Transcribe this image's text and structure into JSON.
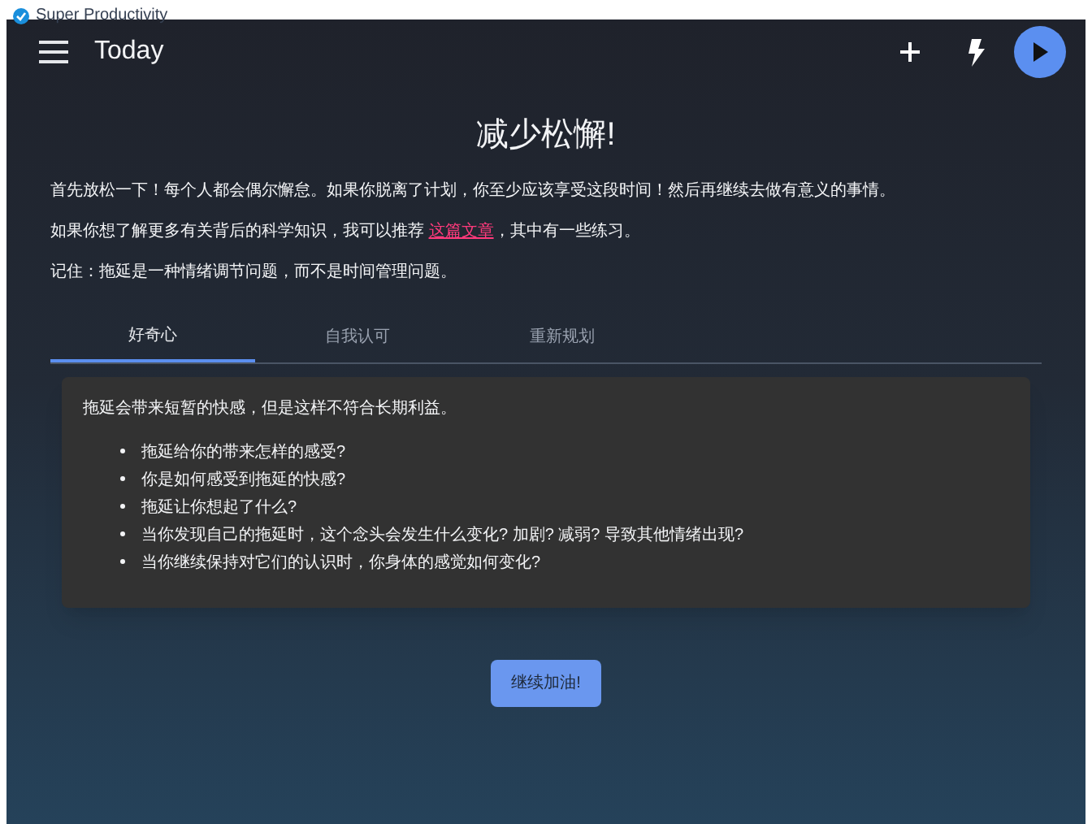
{
  "window": {
    "title": "Super Productivity"
  },
  "toolbar": {
    "title": "Today"
  },
  "heading": "减少松懈!",
  "paragraphs": [
    {
      "kind": "text",
      "text": "首先放松一下！每个人都会偶尔懈怠。如果你脱离了计划，你至少应该享受这段时间！然后再继续去做有意义的事情。"
    },
    {
      "kind": "link",
      "before": "如果你想了解更多有关背后的科学知识，我可以推荐 ",
      "link": "这篇文章",
      "after": "，其中有一些练习。"
    },
    {
      "kind": "text",
      "text": "记住：拖延是一种情绪调节问题，而不是时间管理问题。"
    }
  ],
  "tabs": [
    {
      "label": "好奇心",
      "selected": true
    },
    {
      "label": "自我认可",
      "selected": false
    },
    {
      "label": "重新规划",
      "selected": false
    }
  ],
  "panel": {
    "intro": "拖延会带来短暂的快感，但是这样不符合长期利益。",
    "items": [
      "拖延给你的带来怎样的感受?",
      "你是如何感受到拖延的快感?",
      "拖延让你想起了什么?",
      "当你发现自己的拖延时，这个念头会发生什么变化? 加剧? 减弱? 导致其他情绪出现?",
      "当你继续保持对它们的认识时，你身体的感觉如何变化?"
    ]
  },
  "button": "继续加油!"
}
